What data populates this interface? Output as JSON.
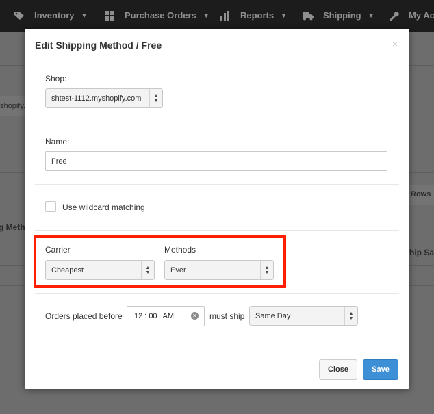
{
  "nav": {
    "items": [
      {
        "label": "Inventory",
        "icon": "tag-icon"
      },
      {
        "label": "Purchase Orders",
        "icon": "grid-icon"
      },
      {
        "label": "Reports",
        "icon": "bar-chart-icon"
      },
      {
        "label": "Shipping",
        "icon": "truck-icon"
      },
      {
        "label": "My Acc",
        "icon": "wrench-icon"
      }
    ]
  },
  "background": {
    "fragment_url": "shopify.",
    "fragment_rows": "Rows",
    "fragment_left": "g Meth",
    "fragment_right": "hip Sa"
  },
  "modal": {
    "title": "Edit Shipping Method / Free",
    "close_glyph": "×",
    "shop": {
      "label": "Shop:",
      "value": "shtest-1112.myshopify.com"
    },
    "name": {
      "label": "Name:",
      "value": "Free"
    },
    "wildcard": {
      "label": "Use wildcard matching",
      "checked": false
    },
    "carrier": {
      "label": "Carrier",
      "value": "Cheapest"
    },
    "methods": {
      "label": "Methods",
      "value": "Ever"
    },
    "orders": {
      "label": "Orders placed before",
      "hour": "12",
      "sep": ":",
      "minute": "00",
      "ampm": "AM",
      "must_ship_label": "must ship",
      "must_ship_value": "Same Day"
    },
    "buttons": {
      "close": "Close",
      "save": "Save"
    }
  },
  "colors": {
    "highlight": "#ff1f00",
    "primary": "#3d8fd6"
  }
}
